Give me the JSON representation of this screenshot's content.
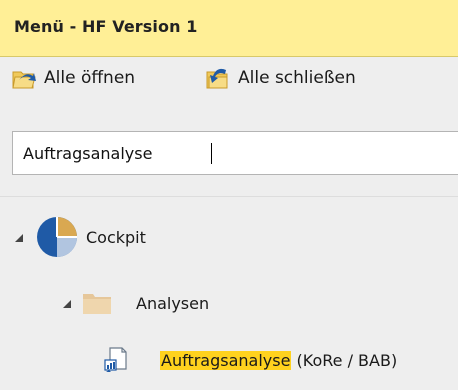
{
  "panel": {
    "title": "Menü - HF Version 1"
  },
  "toolbar": {
    "open_all_label": "Alle öffnen",
    "close_all_label": "Alle schließen"
  },
  "search": {
    "value": "Auftragsanalyse"
  },
  "tree": {
    "root": {
      "label": "Cockpit",
      "expanded": true
    },
    "folder": {
      "label": "Analysen",
      "expanded": true
    },
    "item": {
      "highlighted_text": "Auftragsanalyse",
      "rest_text": " (KoRe / BAB)"
    }
  },
  "colors": {
    "title_bar": "#ffef96",
    "highlight": "#ffd21e",
    "icon_blue": "#1f5aa6",
    "folder": "#e6c79a"
  },
  "icons": {
    "open_all": "folder-open-arrow-icon",
    "close_all": "folder-close-arrow-icon",
    "root": "cockpit-pie-icon",
    "folder": "folder-icon",
    "item": "report-icon"
  }
}
